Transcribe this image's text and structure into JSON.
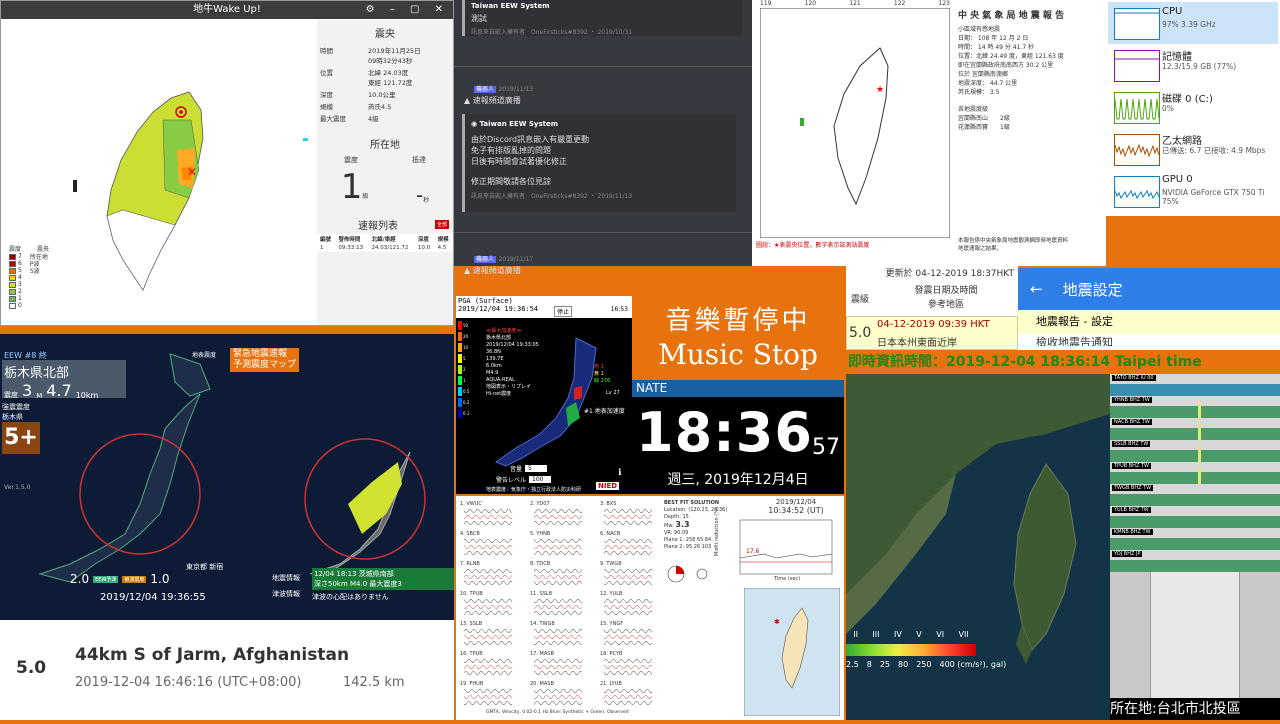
{
  "p1": {
    "title": "地牛Wake Up!",
    "header": "震央",
    "rows": [
      [
        "時間",
        "2019年11月25日\n09時32分43秒"
      ],
      [
        "位置",
        "北緯 24.03度\n東經 121.72度"
      ],
      [
        "深度",
        "10.0公里"
      ],
      [
        "規模",
        "芮氏4.5"
      ],
      [
        "最大震度",
        "4級"
      ]
    ],
    "loc_header": "所在地",
    "col_intensity": "震度",
    "col_arrival": "抵達",
    "intensity_value": "1",
    "intensity_unit": "級",
    "arrival_value": "-",
    "arrival_unit": "秒",
    "list_header": "速報列表",
    "list_badge": "全部",
    "list_cols": [
      "編號",
      "發佈時間",
      "北緯/東經",
      "深度",
      "規模"
    ],
    "list_row": [
      "1",
      "09:33:13",
      "24.03/121.72",
      "10.0",
      "4.5"
    ],
    "legend_title": "震度",
    "legend_title2": "震央",
    "legend_levels": [
      "7",
      "6",
      "5",
      "4",
      "3",
      "2",
      "1",
      "0"
    ],
    "legend_items": [
      "所在地",
      "P波",
      "S波"
    ],
    "legend_colors": [
      "#8b0000",
      "#c00000",
      "#ff6600",
      "#ffcc00",
      "#ccdd33",
      "#88cc44",
      "#66bb66",
      "#ffffff"
    ]
  },
  "p2": {
    "m1_author": "Taiwan EEW System",
    "m1_text": "測試",
    "m1_foot": "訊息來自嵌入擁有者",
    "m1_hash": "OneFirsticks#8392 ・ 2019/10/31",
    "m2_badge": "機器人",
    "m2_date": "2019/11/13",
    "m2_text": "速報頻道廣播",
    "m3_author": "Taiwan EEW System",
    "m3_lines": [
      "由於Discord訊息嵌入有嚴重更動",
      "免子有排版亂掉的問題",
      "日後有時間會試著優化修正",
      "",
      "修正期間敬請各位見諒"
    ],
    "m3_foot": "訊息來自嵌入擁有者",
    "m3_hash": "OneFirsticks#8392 ・ 2019/11/13",
    "m4_badge": "機器人",
    "m4_date": "2019/11/17",
    "m4_text": "速報頻道廣播"
  },
  "p3": {
    "title": "中 央 氣 象 局 地 震 報 告",
    "lines": [
      "小區域有感地震",
      "日期： 108 年 12 月 2 日",
      "時間： 14 時 49 分 41.7 秒",
      "位置：北緯 24.49 度，東經 121.63 度",
      "即在宜蘭縣政府南南西方 30.2 公里",
      "位於 宜蘭縣南澳鄉",
      "地震深度： 44.7 公里",
      "芮氏規模： 3.5",
      "",
      "各地震度級",
      "宜蘭縣南山　　2級",
      "花蓮縣西寶　　1級"
    ],
    "footnote": "圖說：★表震央位置，數字表示該測站震度",
    "side_note": "本報告係中央氣象局地震觀測網即時地震資料\n地震速報之結果。",
    "ticks": [
      "119",
      "120",
      "121",
      "122",
      "123"
    ]
  },
  "p4": {
    "items": [
      {
        "name": "CPU",
        "sub": "97% 3.39 GHz",
        "color": "#117dbb"
      },
      {
        "name": "記憶體",
        "sub": "12.3/15.9 GB (77%)",
        "color": "#8b12ae"
      },
      {
        "name": "磁碟 0 (C:)",
        "sub": "0%",
        "color": "#4da60c"
      },
      {
        "name": "乙太網路",
        "sub": "已傳送: 6.7 已接收: 4.9 Mbps",
        "color": "#a74f01"
      },
      {
        "name": "GPU 0",
        "sub": "NVIDIA GeForce GTX 750 Ti\n75%",
        "color": "#117dbb"
      }
    ]
  },
  "p5": {
    "eew": "EEW #8 終",
    "region": "栃木県北部",
    "shindo_label": "震度",
    "shindo": "3",
    "mag_label": "M",
    "mag": "4.7",
    "depth": "10km",
    "obs_label": "強震震度",
    "obs_region": "栃木県",
    "obs_value": "5+",
    "version": "Ver.1.5.0",
    "map_label": "地表震度",
    "alert1": "緊急地震速報",
    "alert2": "予測震度マップ",
    "left_foot_a": "2.0",
    "left_foot_b": "EEW予測",
    "left_foot_c": "観測震度",
    "left_foot_d": "1.0",
    "left_time": "2019/12/04 19:36:55",
    "left_city": "東京都 新宿",
    "info_label": "地震情報",
    "info_text": "12/04 18:13 茨城県南部\n深さ50km M4.0 最大震度3",
    "tsunami_label": "津波情報",
    "tsunami_text": "津波の心配はありません"
  },
  "p6": {
    "mag": "5.0",
    "place": "44km S of Jarm, Afghanistan",
    "time": "2019-12-04 16:46:16 (UTC+08:00)",
    "depth": "142.5 km"
  },
  "p7": {
    "title": "PGA (Surface)",
    "time": "2019/12/04 19:36:54",
    "stop": "停止",
    "time2": "16:53",
    "lines": [
      "≪最大加速度≫",
      "栃木県北部",
      "2019/12/04 19:33:05",
      "36.8N",
      "139.7E",
      "6.0km",
      "M4.9",
      "AQUA-REAL",
      "地図表示・リプレイ",
      "Hi-net震度"
    ],
    "scale": [
      "50",
      "20",
      "10",
      "5",
      "2",
      "1",
      "0.5",
      "0.2",
      "0.1"
    ],
    "side": [
      "赤 1",
      "黄 1",
      "緑 276"
    ],
    "lv": "Lv 27",
    "caption": "#1 地表加速度",
    "sel1_label": "音量",
    "sel1": "5",
    "sel2_label": "警告レベル",
    "sel2": "100",
    "bottom": "地表震度：気象庁・独立行政法人防災科研",
    "logo": "NIED"
  },
  "p8": {
    "music1": "音樂暫停中",
    "music2": "Music Stop",
    "bar": "NATE",
    "hhmm": "18:36",
    "ss": "57",
    "date": "週三, 2019年12月4日"
  },
  "p9": {
    "stations": [
      "1. VWUC",
      "2. YD07",
      "3. BXS",
      "4. SBCB",
      "5. YHNB",
      "6. NACB",
      "7. RLNB",
      "8. TDCB",
      "9. TWGB",
      "10. TPUB",
      "11. SSLB",
      "12. YULB",
      "13. SSLB",
      "14. TWGB",
      "15. YNGF",
      "16. TPUB",
      "17. MASB",
      "18. PCYB",
      "19. FHUB",
      "20. MASB",
      "21. LYUB"
    ],
    "bf_title": "BEST FIT SOLUTION",
    "bf_loc": "Location: (120.23, 24.36)",
    "bf_depth": "Depth:   15",
    "bf_mw": "Mw:",
    "bf_mw_val": "3.3",
    "bf_vr": "VR:",
    "bf_vr_val": "90.09",
    "plane1": "Plane 1:  258  65  84",
    "plane2": "Plane 2:  95   26  103",
    "date": "2019/12/04",
    "time": "10:34:52  (UT)",
    "pct": "17.6",
    "xlabel": "Time (sec)",
    "ylabel": "Misfit reduction (%)",
    "footer": "GMTA, Velocity, 0.02-0.1 Hz    Blue: Synthetic + Green: Observed"
  },
  "p10": {
    "update": "更新於 04-12-2019 18:37HKT",
    "col_mag": "震級",
    "col_time": "發震日期及時間",
    "col_ref": "參考地區",
    "mag": "5.0",
    "time": "04-12-2019 09:39 HKT",
    "place": "日本本州東面近岸"
  },
  "p11": {
    "title": "地震設定",
    "row1": "地震報告 - 設定",
    "row2": "檢收地震告通知"
  },
  "p12": {
    "banner": "即時資訊時間：2019-12-04 18:36:14 Taipei time",
    "scale_roman": [
      "II",
      "III",
      "IV",
      "V",
      "VI",
      "VII"
    ],
    "scale_nums": [
      "2.5",
      "8",
      "25",
      "80",
      "250",
      "400 (cm/s²), gal)"
    ]
  },
  "p13": {
    "channels": [
      "TATO BHZ IU 00",
      "YHNB BHZ TW",
      "NACB BHZ TW",
      "SSLB BHZ TW",
      "TPUB BHZ TW",
      "TWGB BHZ TW",
      "YULB BHZ TW",
      "KMNB BHZ TW",
      "YOJ BHZ JP"
    ],
    "footer": "所在地:台北市北投區"
  }
}
